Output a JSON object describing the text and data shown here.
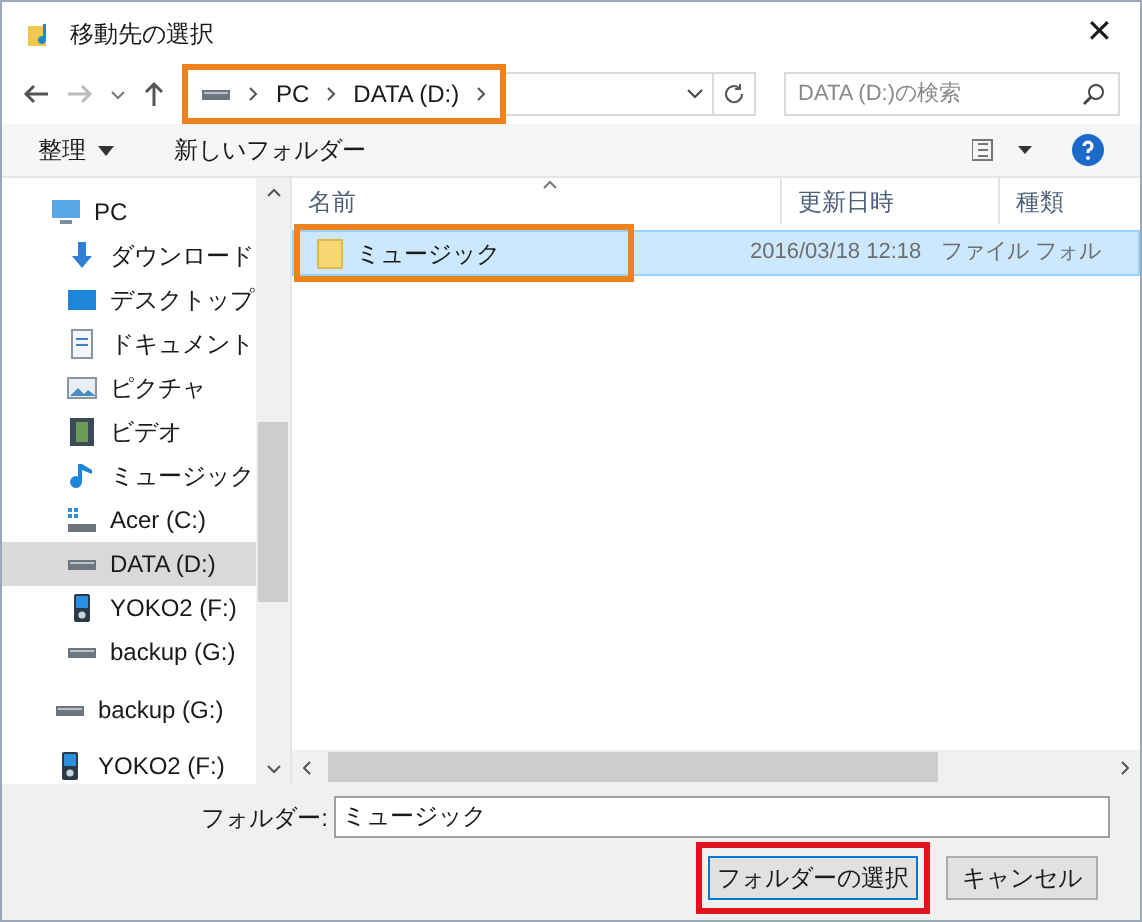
{
  "window": {
    "title": "移動先の選択",
    "close": "✕"
  },
  "address_bar": {
    "crumbs": [
      "PC",
      "DATA (D:)"
    ],
    "color": "#f0821e"
  },
  "search": {
    "placeholder": "DATA (D:)の検索"
  },
  "toolbar": {
    "organize": "整理",
    "new_folder": "新しいフォルダー"
  },
  "nav_tree": [
    {
      "label": "PC",
      "kind": "computer",
      "selected": false,
      "children": [
        {
          "label": "ダウンロード",
          "kind": "download",
          "selected": false
        },
        {
          "label": "デスクトップ",
          "kind": "desktop",
          "selected": false
        },
        {
          "label": "ドキュメント",
          "kind": "document",
          "selected": false
        },
        {
          "label": "ピクチャ",
          "kind": "pictures",
          "selected": false
        },
        {
          "label": "ビデオ",
          "kind": "video",
          "selected": false
        },
        {
          "label": "ミュージック",
          "kind": "music",
          "selected": false
        },
        {
          "label": "Acer (C:)",
          "kind": "system-drive",
          "selected": false
        },
        {
          "label": "DATA (D:)",
          "kind": "drive",
          "selected": true
        },
        {
          "label": "YOKO2 (F:)",
          "kind": "player",
          "selected": false
        },
        {
          "label": "backup (G:)",
          "kind": "drive",
          "selected": false
        }
      ]
    },
    {
      "label": "backup (G:)",
      "kind": "drive",
      "selected": false
    },
    {
      "label": "YOKO2 (F:)",
      "kind": "player",
      "selected": false
    }
  ],
  "file_list": {
    "columns": [
      "名前",
      "更新日時",
      "種類"
    ],
    "rows": [
      {
        "name": "ミュージック",
        "modified": "2016/03/18 12:18",
        "type": "ファイル フォル",
        "selected": true,
        "color": "#f0821e"
      }
    ]
  },
  "folder_field": {
    "label": "フォルダー:",
    "value": "ミュージック"
  },
  "buttons": [
    {
      "label": "フォルダーの選択",
      "kind": "primary",
      "color": "#e0141e"
    },
    {
      "label": "キャンセル",
      "kind": "secondary"
    }
  ]
}
